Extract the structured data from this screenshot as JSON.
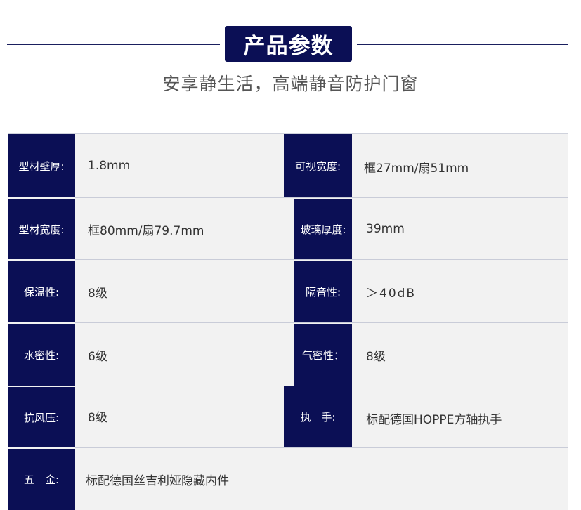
{
  "header": {
    "title": "产品参数",
    "subtitle": "安享静生活，高端静音防护门窗"
  },
  "specs": [
    {
      "label": "型材壁厚:",
      "value": "1.8mm"
    },
    {
      "label": "可视宽度:",
      "value": "框27mm/扇51mm"
    },
    {
      "label": "型材宽度:",
      "value": "框80mm/扇79.7mm"
    },
    {
      "label": "玻璃厚度:",
      "value": "39mm"
    },
    {
      "label": "保温性:",
      "value": "8级"
    },
    {
      "label": "隔音性:",
      "value": "＞40dB"
    },
    {
      "label": "水密性:",
      "value": "6级"
    },
    {
      "label": "气密性：",
      "value": "8级"
    },
    {
      "label": "抗风压:",
      "value": "8级"
    },
    {
      "label": "执　手:",
      "value": "标配德国HOPPE方轴执手"
    },
    {
      "label": "五　金:",
      "value": "标配德国丝吉利娅隐藏内件"
    }
  ]
}
